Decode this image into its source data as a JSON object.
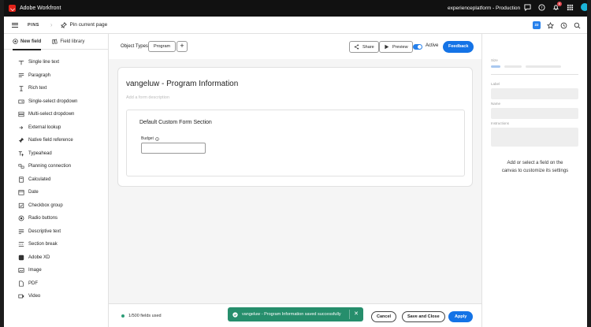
{
  "app": {
    "brand": "Adobe Workfront",
    "org": "experienceplatform - Production",
    "notification_count": "6"
  },
  "nav": {
    "pins_label": "PINS",
    "pin_current_label": "Pin current page",
    "calendar_badge": "22"
  },
  "left_panel": {
    "tabs": [
      {
        "label": "New field"
      },
      {
        "label": "Field library"
      }
    ],
    "fields": [
      {
        "label": "Single line text",
        "icon": "text-field-icon"
      },
      {
        "label": "Paragraph",
        "icon": "paragraph-icon"
      },
      {
        "label": "Rich text",
        "icon": "rich-text-icon"
      },
      {
        "label": "Single-select dropdown",
        "icon": "dropdown-icon"
      },
      {
        "label": "Multi-select dropdown",
        "icon": "multi-dropdown-icon"
      },
      {
        "label": "External lookup",
        "icon": "lookup-icon"
      },
      {
        "label": "Native field reference",
        "icon": "pin-icon"
      },
      {
        "label": "Typeahead",
        "icon": "typeahead-icon"
      },
      {
        "label": "Planning connection",
        "icon": "connection-icon"
      },
      {
        "label": "Calculated",
        "icon": "calculator-icon"
      },
      {
        "label": "Date",
        "icon": "calendar-icon"
      },
      {
        "label": "Checkbox group",
        "icon": "checkbox-icon"
      },
      {
        "label": "Radio buttons",
        "icon": "radio-icon"
      },
      {
        "label": "Descriptive text",
        "icon": "descriptive-text-icon"
      },
      {
        "label": "Section break",
        "icon": "section-break-icon"
      },
      {
        "label": "Adobe XD",
        "icon": "xd-icon"
      },
      {
        "label": "Image",
        "icon": "image-icon"
      },
      {
        "label": "PDF",
        "icon": "pdf-icon"
      },
      {
        "label": "Video",
        "icon": "video-icon"
      }
    ]
  },
  "toolbar": {
    "object_types_label": "Object Types",
    "object_type": "Program",
    "add_label": "+",
    "share_label": "Share",
    "preview_label": "Preview",
    "active_label": "Active",
    "feedback_label": "Feedback"
  },
  "form": {
    "title": "vangeluw - Program Information",
    "description_placeholder": "Add a form description",
    "section_title": "Default Custom Form Section",
    "field_label": "Budget"
  },
  "footer": {
    "field_count": "1/500 fields used",
    "toast_message": "vangeluw - Program Information saved successfully",
    "close_label": "✕",
    "cancel_label": "Cancel",
    "save_close_label": "Save and Close",
    "apply_label": "Apply"
  },
  "right_panel": {
    "size_label": "Size",
    "label_label": "Label",
    "name_label": "Name",
    "instructions_label": "Instructions",
    "hint": "Add or select a field on the canvas to customize its settings"
  },
  "colors": {
    "accent": "#1473e6",
    "toast": "#268e6c",
    "topbar": "#111111"
  }
}
